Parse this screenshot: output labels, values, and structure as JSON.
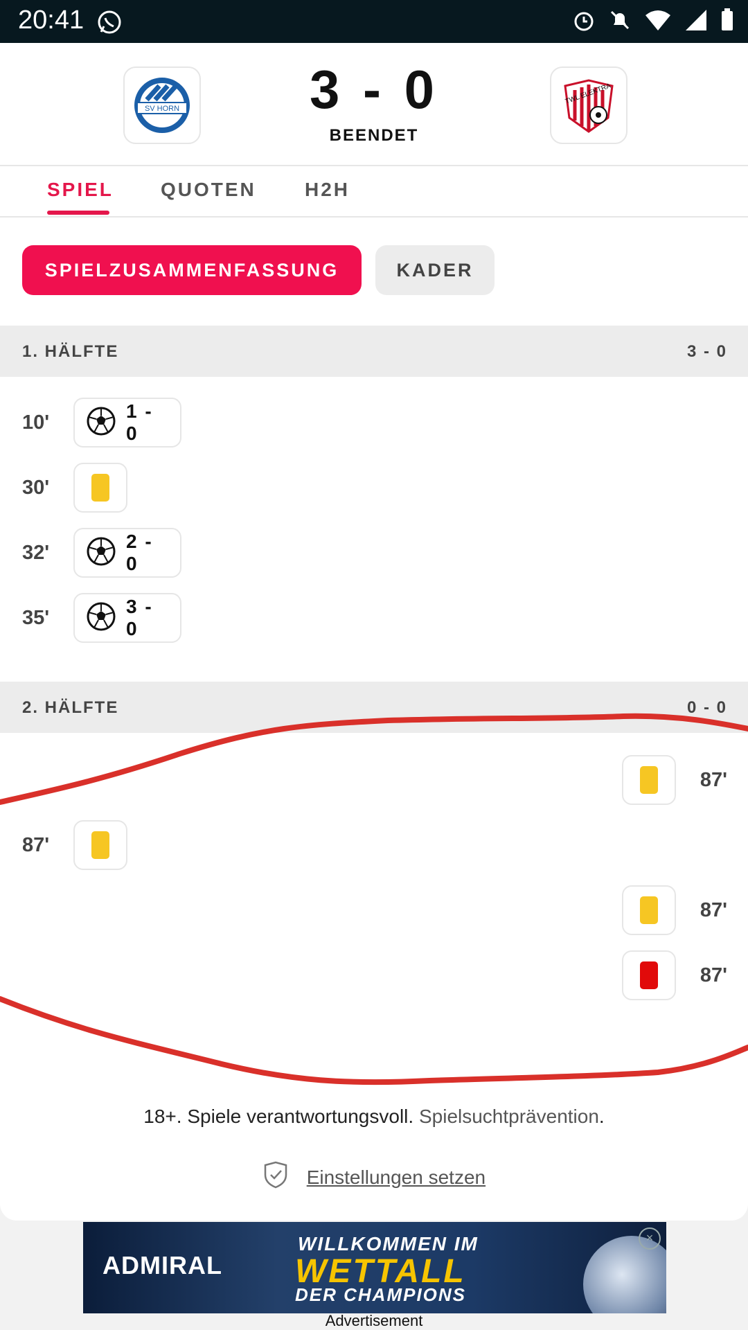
{
  "statusbar": {
    "time": "20:41"
  },
  "match": {
    "score": "3 - 0",
    "status": "BEENDET",
    "home_logo_text": "SV HORN",
    "away_logo_text": "TWL ELEKTRA"
  },
  "tabs": [
    "SPIEL",
    "QUOTEN",
    "H2H"
  ],
  "subtabs": {
    "primary": "SPIELZUSAMMENFASSUNG",
    "secondary": "KADER"
  },
  "half1": {
    "title": "1. HÄLFTE",
    "result": "3 - 0",
    "events": [
      {
        "minute": "10'",
        "score": "1 - 0"
      },
      {
        "minute": "30'"
      },
      {
        "minute": "32'",
        "score": "2 - 0"
      },
      {
        "minute": "35'",
        "score": "3 - 0"
      }
    ]
  },
  "half2": {
    "title": "2. HÄLFTE",
    "result": "0 - 0",
    "events": [
      {
        "minute": "87'"
      },
      {
        "minute": "87'"
      },
      {
        "minute": "87'"
      },
      {
        "minute": "87'"
      }
    ]
  },
  "footer": {
    "age_text": "18+. Spiele verantwortungsvoll.",
    "prevention_link": "Spielsuchtprävention",
    "period": ".",
    "settings_link": "Einstellungen setzen"
  },
  "ad": {
    "brand": "ADMIRAL",
    "line1": "WILLKOMMEN IM",
    "line2": "WETTALL",
    "line3": "DER CHAMPIONS",
    "label": "Advertisement"
  },
  "colors": {
    "accent": "#e4174b",
    "yellow_card": "#f6c623",
    "red_card": "#e10a0a",
    "annotation": "#d9302a"
  },
  "icons": [
    "whatsapp-icon",
    "alarm-icon",
    "bell-off-icon",
    "wifi-icon",
    "signal-icon",
    "battery-icon",
    "soccer-ball-icon",
    "yellow-card-icon",
    "red-card-icon",
    "shield-check-icon",
    "close-ad-icon"
  ]
}
